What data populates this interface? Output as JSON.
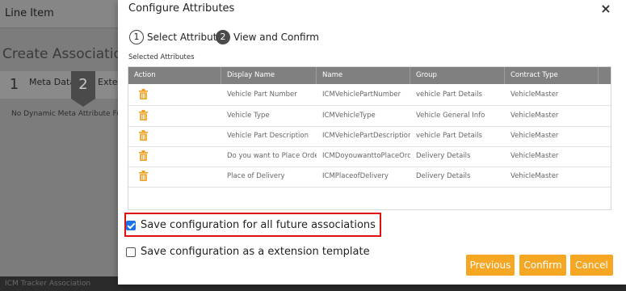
{
  "background": {
    "page_title": "Line Item",
    "section_title": "Create Association - Li",
    "steps": [
      {
        "number": "1",
        "label": "Meta Data"
      },
      {
        "number": "2",
        "label": "Extern"
      }
    ],
    "empty_message": "No Dynamic Meta Attribute Found",
    "footer_text": "ICM Tracker Association"
  },
  "modal": {
    "title": "Configure Attributes",
    "close_icon": "×",
    "steps": [
      {
        "number": "1",
        "label": "Select Attributes"
      },
      {
        "number": "2",
        "label": "View and Confirm"
      }
    ],
    "selected_label": "Selected Attributes",
    "table": {
      "columns": [
        "Action",
        "Display Name",
        "Name",
        "Group",
        "Contract Type"
      ],
      "rows": [
        {
          "display_name": "Vehicle Part Number",
          "name": "ICMVehiclePartNumber",
          "group": "vehicle Part Details",
          "contract_type": "VehicleMaster"
        },
        {
          "display_name": "Vehicle Type",
          "name": "ICMVehicleType",
          "group": "Vehicle General Info",
          "contract_type": "VehicleMaster"
        },
        {
          "display_name": "Vehicle Part Description",
          "name": "ICMVehiclePartDescription",
          "group": "vehicle Part Details",
          "contract_type": "VehicleMaster"
        },
        {
          "display_name": "Do you want to Place Order",
          "name": "ICMDoyouwanttoPlaceOrder",
          "group": "Delivery Details",
          "contract_type": "VehicleMaster"
        },
        {
          "display_name": "Place of Delivery",
          "name": "ICMPlaceofDelivery",
          "group": "Delivery Details",
          "contract_type": "VehicleMaster"
        }
      ]
    },
    "options": {
      "save_future": {
        "label": "Save configuration for all future associations",
        "checked": true
      },
      "save_template": {
        "label": "Save configuration as a extension template",
        "checked": false
      }
    },
    "buttons": {
      "previous": "Previous",
      "confirm": "Confirm",
      "cancel": "Cancel"
    }
  },
  "colors": {
    "accent_button": "#f5a623",
    "trash_icon": "#f0a020",
    "table_header": "#808080",
    "highlight_border": "#e01010"
  },
  "icons": {
    "action": "trash-icon",
    "close": "close-icon"
  }
}
